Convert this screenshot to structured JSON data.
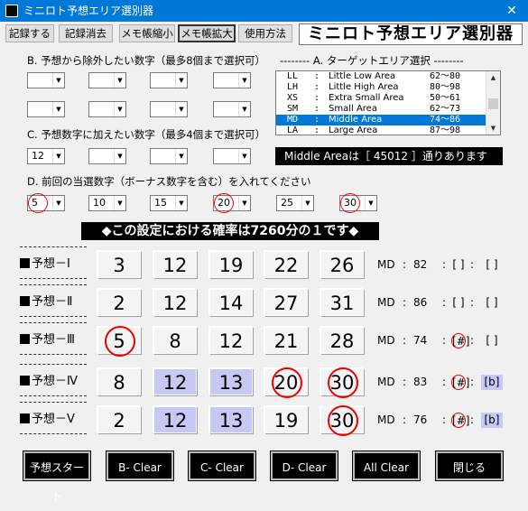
{
  "window": {
    "title": "ミニロト予想エリア選別器",
    "close_glyph": "✕"
  },
  "menu": [
    {
      "label": "記録する"
    },
    {
      "label": "記録消去"
    },
    {
      "label": "メモ帳縮小"
    },
    {
      "label": "メモ帳拡大",
      "active": true
    },
    {
      "label": "使用方法"
    }
  ],
  "app_title": "ミニロト予想エリア選別器",
  "section_b": {
    "label": "B. 予想から除外したい数字（最多8個まで選択可）",
    "values": [
      "",
      "",
      "",
      "",
      "",
      "",
      "",
      ""
    ]
  },
  "section_a": {
    "label": "-------- A. ターゲットエリア選択 --------"
  },
  "areas": [
    {
      "code": "LL",
      "colon": ":",
      "name": "Little Low Area",
      "range": "62〜80"
    },
    {
      "code": "LH",
      "colon": ":",
      "name": "Little High Area",
      "range": "80〜98"
    },
    {
      "code": "XS",
      "colon": ":",
      "name": "Extra Small Area",
      "range": "50〜61"
    },
    {
      "code": "SM",
      "colon": ":",
      "name": "Small Area",
      "range": "62〜73"
    },
    {
      "code": "MD",
      "colon": ":",
      "name": "Middle Area",
      "range": "74〜86",
      "selected": true
    },
    {
      "code": "LA",
      "colon": ":",
      "name": "Large Area",
      "range": "87〜98"
    }
  ],
  "section_c": {
    "label": "C. 予想数字に加えたい数字（最多4個まで選択可）",
    "values": [
      "12",
      "",
      "",
      ""
    ]
  },
  "info_text": "Middle Areaは［ 45012 ］通りあります",
  "section_d": {
    "label": "D. 前回の当選数字（ボーナス数字を含む）を入れてください",
    "values": [
      {
        "v": "5",
        "circled": true
      },
      {
        "v": "10",
        "circled": false
      },
      {
        "v": "15",
        "circled": false
      },
      {
        "v": "20",
        "circled": true
      },
      {
        "v": "25",
        "circled": false
      },
      {
        "v": "30",
        "circled": true
      }
    ]
  },
  "probability_text": "◆この設定における確率は7260分の１です◆",
  "predictions": [
    {
      "label": "予想－Ⅰ",
      "numbers": [
        {
          "n": "3"
        },
        {
          "n": "12"
        },
        {
          "n": "19"
        },
        {
          "n": "22"
        },
        {
          "n": "26"
        }
      ],
      "area": "MD",
      "sum": "82",
      "m1": {
        "t": "[ ]",
        "style": "plain"
      },
      "m2": {
        "t": "[ ]",
        "style": "plain"
      }
    },
    {
      "label": "予想－Ⅱ",
      "numbers": [
        {
          "n": "2"
        },
        {
          "n": "12"
        },
        {
          "n": "14"
        },
        {
          "n": "27"
        },
        {
          "n": "31"
        }
      ],
      "area": "MD",
      "sum": "86",
      "m1": {
        "t": "[ ]",
        "style": "plain"
      },
      "m2": {
        "t": "[ ]",
        "style": "plain"
      }
    },
    {
      "label": "予想－Ⅲ",
      "numbers": [
        {
          "n": "5",
          "ring": true
        },
        {
          "n": "8"
        },
        {
          "n": "12"
        },
        {
          "n": "21"
        },
        {
          "n": "28"
        }
      ],
      "area": "MD",
      "sum": "74",
      "m1": {
        "t": "[#]",
        "style": "circled"
      },
      "m2": {
        "t": "[ ]",
        "style": "plain"
      }
    },
    {
      "label": "予想－Ⅳ",
      "numbers": [
        {
          "n": "8"
        },
        {
          "n": "12",
          "hl": true
        },
        {
          "n": "13",
          "hl": true
        },
        {
          "n": "20",
          "ring": true
        },
        {
          "n": "30",
          "ring": true
        }
      ],
      "area": "MD",
      "sum": "83",
      "m1": {
        "t": "[#]",
        "style": "circled"
      },
      "m2": {
        "t": "[b]",
        "style": "flat"
      }
    },
    {
      "label": "予想－Ⅴ",
      "numbers": [
        {
          "n": "2"
        },
        {
          "n": "12",
          "hl": true
        },
        {
          "n": "13",
          "hl": true
        },
        {
          "n": "19"
        },
        {
          "n": "30",
          "ring": true
        }
      ],
      "area": "MD",
      "sum": "76",
      "m1": {
        "t": "[#]",
        "style": "circled"
      },
      "m2": {
        "t": "[b]",
        "style": "flat"
      }
    }
  ],
  "buttons": [
    "予想スタート",
    "B- Clear",
    "C- Clear",
    "D- Clear",
    "All Clear",
    "閉じる"
  ],
  "colors": {
    "titlebar": "#0078d7",
    "selection": "#0078d7",
    "highlight": "#c8c8f5",
    "circle": "#e00000"
  }
}
